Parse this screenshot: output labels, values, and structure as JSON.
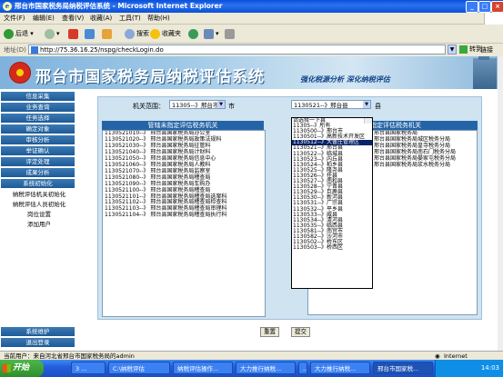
{
  "window": {
    "title": "邢台市国家税务局纳税评估系统 - Microsoft Internet Explorer",
    "icon": "ie-icon"
  },
  "menu": [
    "文件(F)",
    "编辑(E)",
    "查看(V)",
    "收藏(A)",
    "工具(T)",
    "帮助(H)"
  ],
  "toolbar": {
    "back": "后退",
    "search": "搜索",
    "favorites": "收藏夹"
  },
  "address": {
    "label": "地址(D)",
    "url": "http://75.36.16.25/nspg/checkLogin.do",
    "go": "转到",
    "links": "链接"
  },
  "banner": {
    "title": "邢台市国家税务局纳税评估系统",
    "slogan": "强化税源分析  深化纳税评估"
  },
  "sidebar": {
    "items": [
      "信息采集",
      "业务查询",
      "任务选择",
      "确定对象",
      "审核分析",
      "举证确认",
      "评定处理",
      "成果分析",
      "系统初始化"
    ],
    "subitems": [
      "纳税评估机关初始化",
      "纳税评估人员初始化",
      "岗位设置",
      "添加用户"
    ],
    "bottom": [
      "系统维护",
      "退出登录"
    ]
  },
  "filter": {
    "org_label": "机关范围：",
    "org_value": "11305--》邢台市",
    "city_suffix": "市",
    "county_value": "1130521--》邢台县",
    "county_suffix": "县"
  },
  "left_list": {
    "header": "管辖未指定评估税务机关",
    "items": [
      "1130521010--》 邢台县国家税务局办公室",
      "1130521020--》 邢台县国家税务局政策法规科",
      "1130521030--》 邢台县国家税务局征管科",
      "1130521040--》 邢台县国家税务局计财科",
      "1130521050--》 邢台县国家税务局信息中心",
      "1130521060--》 邢台县国家税务局人教科",
      "1130521070--》 邢台县国家税务局监察室",
      "1130521080--》 邢台县国家税务局稽查局",
      "1130521090--》 邢台县国家税务局车购办",
      "1130521100--》 邢台县国家税务局稽查局",
      "1130521101--》 邢台县国家税务局稽查局选案科",
      "1130521102--》 邢台县国家税务局稽查局检查科",
      "1130521103--》 邢台县国家税务局稽查局审理科",
      "1130521104--》 邢台县国家税务局稽查局执行科"
    ]
  },
  "right_list": {
    "header": "已指定评估税务机关",
    "items": [
      "邢台县国家税务局",
      "邢台县国家税务局城区税务分局",
      "邢台县国家税务局皇寺税务分局",
      "邢台县国家税务局南石门税务分局",
      "邢台县国家税务局晏家屯税务分局",
      "邢台县国家税务局浆水税务分局"
    ]
  },
  "dropdown": {
    "items": [
      "请选择一下县",
      "11305--》所有",
      "1130500--》邢台市",
      "1130501--》高新技术开发区",
      "1130512--》大曹庄管理区",
      "1130521--》邢台县",
      "1130522--》临城县",
      "1130523--》内丘县",
      "1130524--》柏乡县",
      "1130525--》隆尧县",
      "1130526--》任县",
      "1130527--》南和县",
      "1130528--》宁晋县",
      "1130529--》巨鹿县",
      "1130530--》新河县",
      "1130531--》广宗县",
      "1130532--》平乡县",
      "1130533--》威县",
      "1130534--》清河县",
      "1130535--》临西县",
      "1130581--》南宫市",
      "1130582--》沙河市",
      "1130502--》桥东区",
      "1130503--》桥西区"
    ],
    "highlighted_index": 4
  },
  "buttons": {
    "reset": "重置",
    "submit": "提交"
  },
  "status": {
    "text": "当前用户：来自河北省邢台市国家税务局的admin",
    "zone": "Internet"
  },
  "taskbar": {
    "start": "开始",
    "tasks": [
      "3 ...",
      "C:\\纳税评估",
      "纳税评估操作...",
      "大力推行纳税...",
      "...",
      "大力推行纳税...",
      "邢台市国家税..."
    ],
    "time": "14:03"
  },
  "colors": {
    "nav": "#1d5a96",
    "panel": "#cfe3f1",
    "highlight": "#0a246a"
  }
}
